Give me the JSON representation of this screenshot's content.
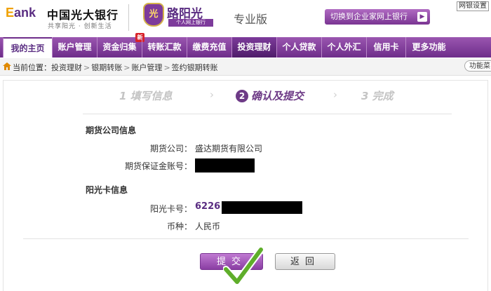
{
  "header": {
    "logo_e": "E",
    "logo_ank": "ank",
    "bank_name": "中国光大银行",
    "slogan": "共享阳光 · 创新生活",
    "emblem_text": "光",
    "brand_name": "路阳光",
    "brand_sub": "个人网上银行",
    "edition": "专业版",
    "switch_label": "切换到企业家网上银行",
    "top_link": "网银设置"
  },
  "nav": {
    "items": [
      {
        "label": "我的主页"
      },
      {
        "label": "账户管理"
      },
      {
        "label": "资金归集",
        "badge": "新"
      },
      {
        "label": "转账汇款"
      },
      {
        "label": "缴费充值"
      },
      {
        "label": "投资理财"
      },
      {
        "label": "个人贷款"
      },
      {
        "label": "个人外汇"
      },
      {
        "label": "信用卡"
      },
      {
        "label": "更多功能"
      }
    ]
  },
  "breadcrumb": {
    "prefix": "当前位置：",
    "items": [
      "投资理财",
      "银期转账",
      "账户管理",
      "签约银期转账"
    ],
    "sep": ">",
    "func_button": "功能菜"
  },
  "steps": [
    {
      "num": "1",
      "label": "填写信息"
    },
    {
      "num": "2",
      "label": "确认及提交"
    },
    {
      "num": "3",
      "label": "完成"
    }
  ],
  "futures": {
    "title": "期货公司信息",
    "company_label": "期货公司：",
    "company_value": "盛达期货有限公司",
    "account_label": "期货保证金账号："
  },
  "card": {
    "title": "阳光卡信息",
    "card_label": "阳光卡号：",
    "card_prefix": "6226",
    "currency_label": "币种：",
    "currency_value": "人民币"
  },
  "actions": {
    "submit": "提交",
    "back": "返回"
  },
  "colors": {
    "brand_purple": "#6d3a86",
    "nav_purple": "#7d3b9b",
    "logo_orange": "#f0a000"
  }
}
